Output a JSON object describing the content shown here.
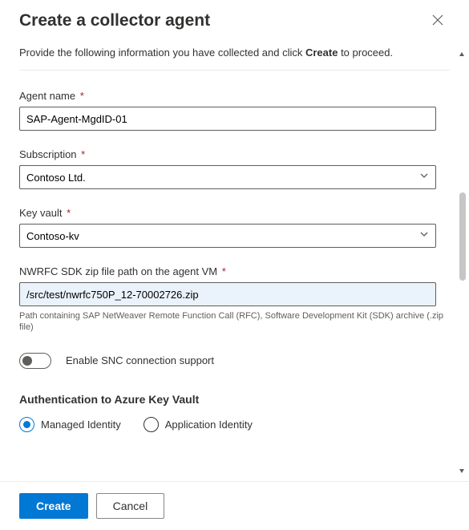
{
  "header": {
    "title": "Create a collector agent"
  },
  "intro": {
    "prefix": "Provide the following information you have collected and click ",
    "bold": "Create",
    "suffix": " to proceed."
  },
  "fields": {
    "agent_name": {
      "label": "Agent name",
      "value": "SAP-Agent-MgdID-01"
    },
    "subscription": {
      "label": "Subscription",
      "value": "Contoso Ltd."
    },
    "key_vault": {
      "label": "Key vault",
      "value": "Contoso-kv"
    },
    "sdk_path": {
      "label": "NWRFC SDK zip file path on the agent VM",
      "value": "/src/test/nwrfc750P_12-70002726.zip",
      "hint": "Path containing SAP NetWeaver Remote Function Call (RFC), Software Development Kit (SDK) archive (.zip file)"
    }
  },
  "toggle": {
    "snc_label": "Enable SNC connection support",
    "enabled": false
  },
  "auth": {
    "section": "Authentication to Azure Key Vault",
    "options": {
      "managed": "Managed Identity",
      "application": "Application Identity"
    },
    "selected": "managed"
  },
  "footer": {
    "create": "Create",
    "cancel": "Cancel"
  },
  "required_marker": "*"
}
